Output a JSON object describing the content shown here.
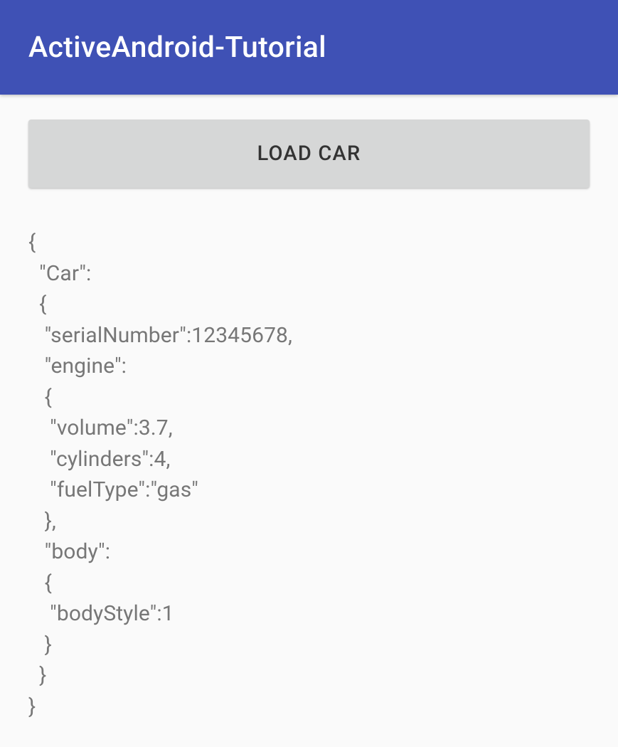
{
  "toolbar": {
    "title": "ActiveAndroid-Tutorial"
  },
  "main": {
    "loadButtonLabel": "LOAD CAR",
    "jsonOutput": "{\n  \"Car\":\n  {\n   \"serialNumber\":12345678,\n   \"engine\":\n   {\n    \"volume\":3.7,\n    \"cylinders\":4,\n    \"fuelType\":\"gas\"\n   },\n   \"body\":\n   {\n    \"bodyStyle\":1\n   }\n  }\n}"
  }
}
